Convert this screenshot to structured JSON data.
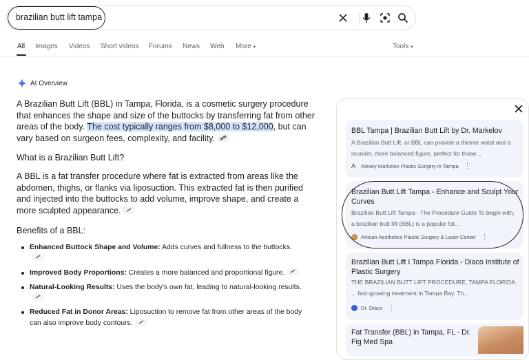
{
  "search": {
    "query": "brazilian butt lift tampa"
  },
  "tabs": [
    {
      "label": "All"
    },
    {
      "label": "Images"
    },
    {
      "label": "Videos"
    },
    {
      "label": "Short videos"
    },
    {
      "label": "Forums"
    },
    {
      "label": "News"
    },
    {
      "label": "Web"
    },
    {
      "label": "More"
    },
    {
      "label": "Tools"
    }
  ],
  "ai": {
    "title": "AI Overview",
    "p1_a": "A Brazilian Butt Lift (BBL) in Tampa, Florida, is a cosmetic surgery procedure that enhances the shape and size of the buttocks by transferring fat from other areas of the body. ",
    "p1_hl": "The cost typically ranges from $8,000 to $12,000",
    "p1_b": ", but can vary based on surgeon fees, complexity, and facility.",
    "q1": "What is a Brazilian Butt Lift?",
    "p2": "A BBL is a fat transfer procedure where fat is extracted from areas like the abdomen, thighs, or flanks via liposuction. This extracted fat is then purified and injected into the buttocks to add volume, improve shape, and create a more sculpted appearance.",
    "q2": "Benefits of a BBL:",
    "benefits": [
      {
        "bold": "Enhanced Buttock Shape and Volume:",
        "text": " Adds curves and fullness to the buttocks."
      },
      {
        "bold": "Improved Body Proportions:",
        "text": " Creates a more balanced and proportional figure."
      },
      {
        "bold": "Natural-Looking Results:",
        "text": " Uses the body's own fat, leading to natural-looking results."
      },
      {
        "bold": "Reduced Fat in Donor Areas:",
        "text": " Liposuction to remove fat from other areas of the body can also improve body contours."
      }
    ]
  },
  "sources": [
    {
      "title": "BBL Tampa | Brazilian Butt Lift by Dr. Markelov",
      "snippet": "A Brazilian Butt Lift, or BBL can provide a thinner waist and a rounder, more balanced figure, perfect for those...",
      "site": "Alexey Markelov Plastic Surgery in Tampa"
    },
    {
      "title": "Brazilian Butt Lift Tampa - Enhance and Sculpt Your Curves",
      "snippet": "Brazilian Butt Lift Tampa - The Procedure Guide To begin with, a brazilian butt lift (BBL) is a popular fat...",
      "site": "Artisan Aesthetics Plastic Surgery & Laser Center"
    },
    {
      "title": "Brazilian Butt Lift I Tampa Florida - Diaco Institute of Plastic Surgery",
      "snippet": "THE BRAZILIAN BUTT LIFT PROCEDURE, TAMPA FLORIDA. ... fast-growing treatment in Tampa Bay. Th...",
      "site": "Dr. Diaco"
    },
    {
      "title": "Fat Transfer (BBL) in Tampa, FL - Dr. Fig Med Spa",
      "snippet": "",
      "site": ""
    }
  ],
  "colors": {
    "highlight": "#d3e3fd",
    "card_bg": "#f1f4fa",
    "ai_sparkle": "#4c6ef5"
  }
}
